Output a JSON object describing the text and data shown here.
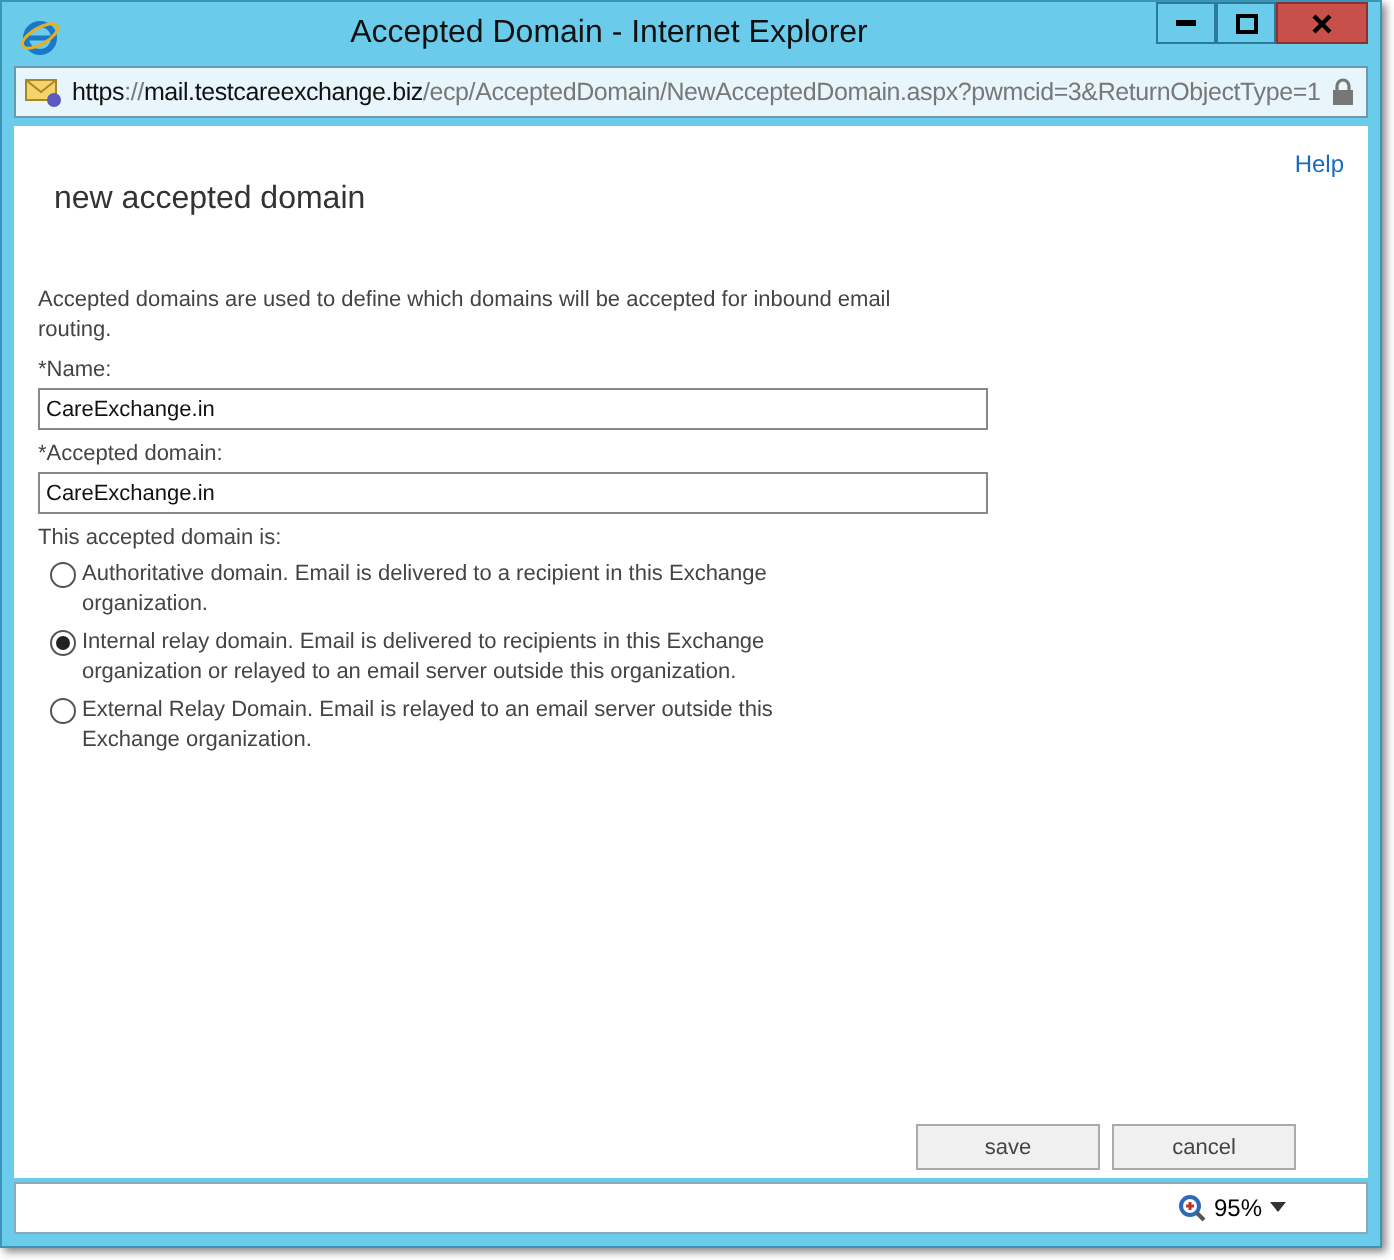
{
  "window": {
    "title": "Accepted Domain - Internet Explorer"
  },
  "address_bar": {
    "segments": [
      {
        "text": "https",
        "emphasis": true
      },
      {
        "text": "://",
        "emphasis": false
      },
      {
        "text": "mail.testcareexchange.biz",
        "emphasis": true
      },
      {
        "text": "/ecp/AcceptedDomain/NewAcceptedDomain.aspx?pwmcid=3&ReturnObjectType=1",
        "emphasis": false
      }
    ]
  },
  "help_link": "Help",
  "heading": "new accepted domain",
  "description": "Accepted domains are used to define which domains will be accepted for inbound email routing.",
  "fields": [
    {
      "label": "*Name:",
      "value": "CareExchange.in"
    },
    {
      "label": "*Accepted domain:",
      "value": "CareExchange.in"
    }
  ],
  "domain_type": {
    "label": "This accepted domain is:",
    "options": [
      {
        "label": "Authoritative domain. Email is delivered to a recipient in this Exchange organization.",
        "selected": false
      },
      {
        "label": "Internal relay domain. Email is delivered to recipients in this Exchange organization or relayed to an email server outside this organization.",
        "selected": true
      },
      {
        "label": "External Relay Domain. Email is relayed to an email server outside this Exchange organization.",
        "selected": false
      }
    ]
  },
  "buttons": [
    "save",
    "cancel"
  ],
  "status_bar": {
    "zoom": "95%"
  }
}
